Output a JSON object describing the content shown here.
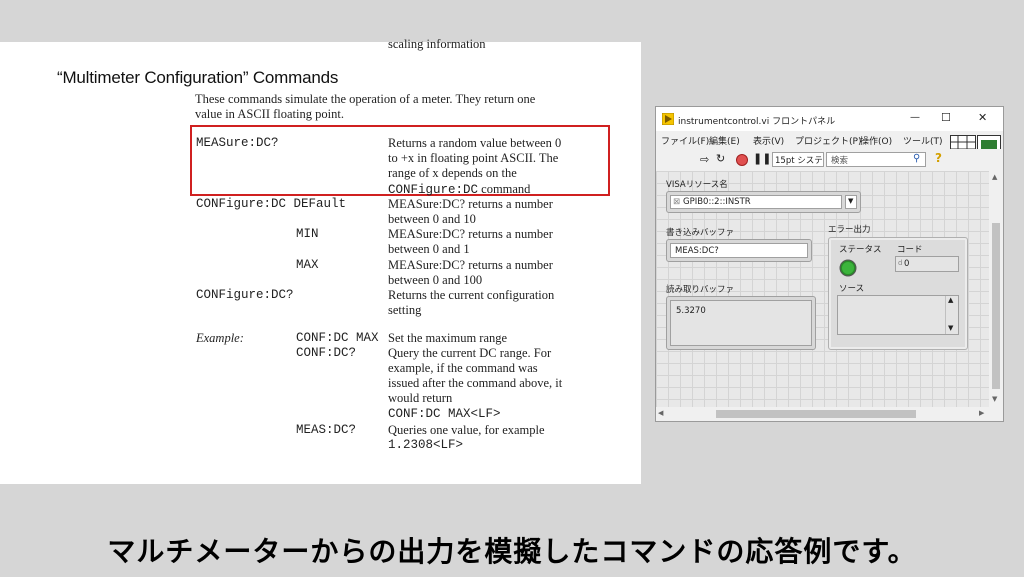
{
  "document": {
    "top_fragment": "scaling information",
    "heading": "“Multimeter Configuration” Commands",
    "intro_line1": "These commands simulate the operation of a meter. They return one",
    "intro_line2": "value in ASCII floating point.",
    "rows": {
      "meas_cmd": "MEASure:DC?",
      "meas_desc": [
        "Returns a random value between 0",
        "to +x in floating point ASCII. The",
        "range of x depends on the"
      ],
      "meas_desc_mono": "CONFigure:DC",
      "meas_desc_tail": " command",
      "conf_cmd": "CONFigure:DC DEFault",
      "conf_default_desc": [
        "MEASure:DC? returns a number",
        "between 0 and 10"
      ],
      "min_label": "MIN",
      "conf_min_desc": [
        "MEASure:DC? returns a number",
        "between 0 and 1"
      ],
      "max_label": "MAX",
      "conf_max_desc": [
        "MEASure:DC? returns a number",
        "between 0 and 100"
      ],
      "confq_cmd": "CONFigure:DC?",
      "confq_desc": [
        "Returns the current configuration",
        "setting"
      ]
    },
    "example": {
      "label": "Example:",
      "cmd1": "CONF:DC MAX",
      "cmd1_desc": "Set the maximum range",
      "cmd2": "CONF:DC?",
      "cmd2_desc": [
        "Query the current DC range. For",
        "example, if the command was",
        "issued after the command above, it",
        "would return"
      ],
      "cmd2_result": "CONF:DC MAX<LF>",
      "cmd3": "MEAS:DC?",
      "cmd3_desc": "Queries one value, for example",
      "cmd3_result": "1.2308<LF>"
    }
  },
  "window": {
    "title": "instrumentcontrol.vi フロントパネル",
    "minimize": "—",
    "maximize": "☐",
    "close": "✕",
    "menus": [
      "ファイル(F)",
      "編集(E)",
      "表示(V)",
      "プロジェクト(P)",
      "操作(O)",
      "ツール(T)"
    ],
    "font_select": "15pt システ",
    "search_placeholder": "検索",
    "help": "?",
    "visa_label": "VISAリソース名",
    "visa_value": "GPIB0::2::INSTR",
    "write_label": "書き込みバッファ",
    "write_value": "MEAS:DC?",
    "read_label": "読み取りバッファ",
    "read_value": "5.3270",
    "error_label": "エラー出力",
    "status_label": "ステータス",
    "code_label": "コード",
    "code_value": "0",
    "code_prefix": "d",
    "source_label": "ソース",
    "status_color": "#3cb43c",
    "connector_number": "4"
  },
  "caption": "マルチメーターからの出力を模擬したコマンドの応答例です。"
}
